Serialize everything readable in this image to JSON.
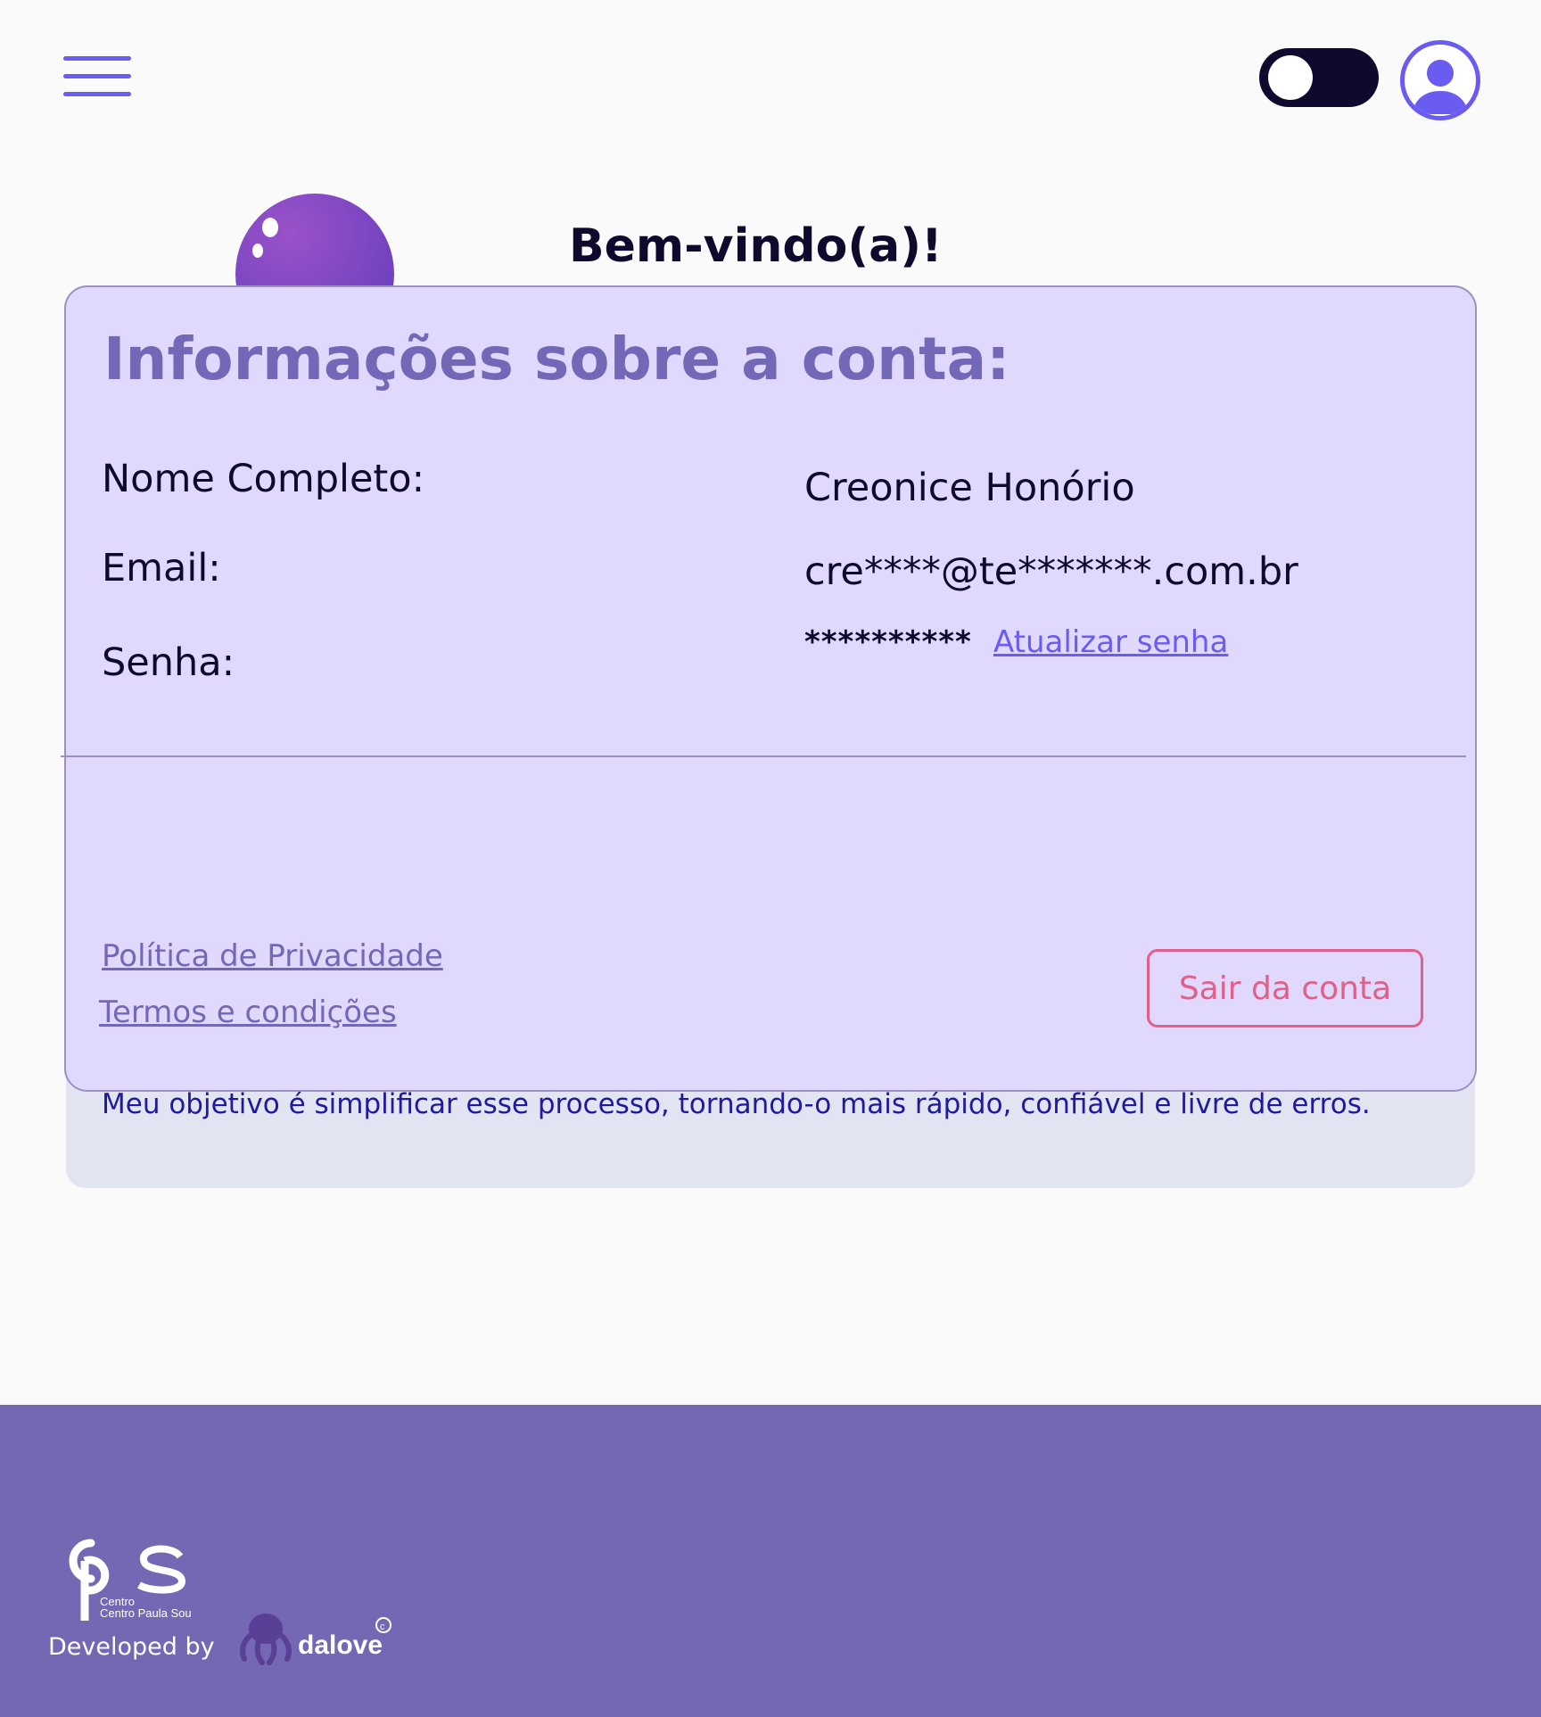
{
  "header": {
    "menu_icon": "hamburger-menu-icon",
    "theme_toggle_icon": "toggle-switch",
    "profile_icon": "user-circle-icon"
  },
  "welcome": "Bem-vindo(a)!",
  "about_text": "Meu objetivo é simplificar esse processo, tornando-o mais rápido, confiável e livre de erros.",
  "account_modal": {
    "title": "Informações sobre a conta:",
    "fields": [
      {
        "label": "Nome Completo:",
        "value": "Creonice Honório"
      },
      {
        "label": "Email:",
        "value": "cre****@te*******.com.br"
      },
      {
        "label": "Senha:",
        "value": "**********"
      }
    ],
    "update_password_link": "Atualizar senha",
    "privacy_link": "Política de Privacidade",
    "terms_link": "Termos e condições",
    "logout_button": "Sair da conta"
  },
  "footer": {
    "cps_logo_text": "Centro Paula Souza",
    "developed_by": "Developed by",
    "dalove_logo_text": "dalove"
  },
  "colors": {
    "accent": "#6a5cf0",
    "modal_bg": "#e1d9fd",
    "title": "#7368b7",
    "logout": "#e0608a",
    "footer_bg": "#7468b5"
  }
}
